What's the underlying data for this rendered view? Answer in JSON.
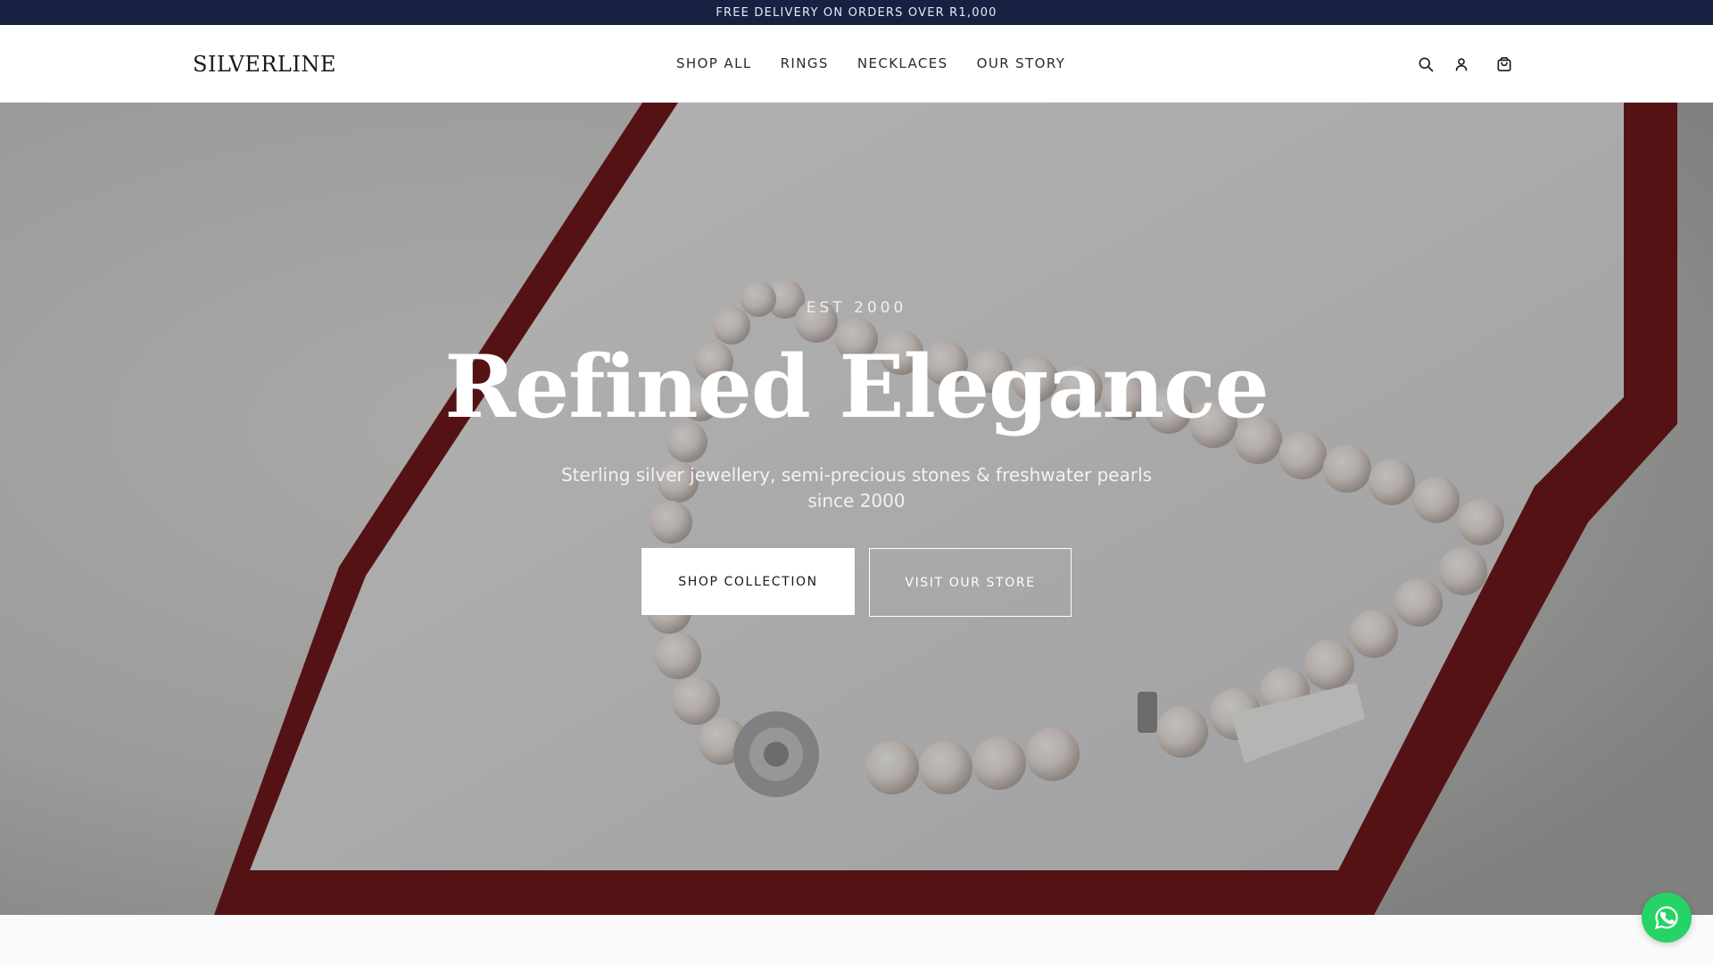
{
  "announcement": {
    "text": "FREE DELIVERY ON ORDERS OVER R1,000"
  },
  "header": {
    "logo": "SILVERLINE",
    "nav": [
      "SHOP ALL",
      "RINGS",
      "NECKLACES",
      "OUR STORY"
    ],
    "icons": [
      "search-icon",
      "account-icon",
      "cart-icon"
    ]
  },
  "hero": {
    "eyebrow": "EST 2000",
    "headline": "Refined Elegance",
    "subline": "Sterling silver jewellery, semi-precious stones & freshwater pearls since 2000",
    "primary_cta": "SHOP COLLECTION",
    "secondary_cta": "VISIT OUR STORE"
  },
  "floating": {
    "icon": "whatsapp-icon"
  },
  "colors": {
    "announcement_bg": "#172142",
    "whatsapp": "#25d366",
    "box_red": "#6e1114"
  }
}
